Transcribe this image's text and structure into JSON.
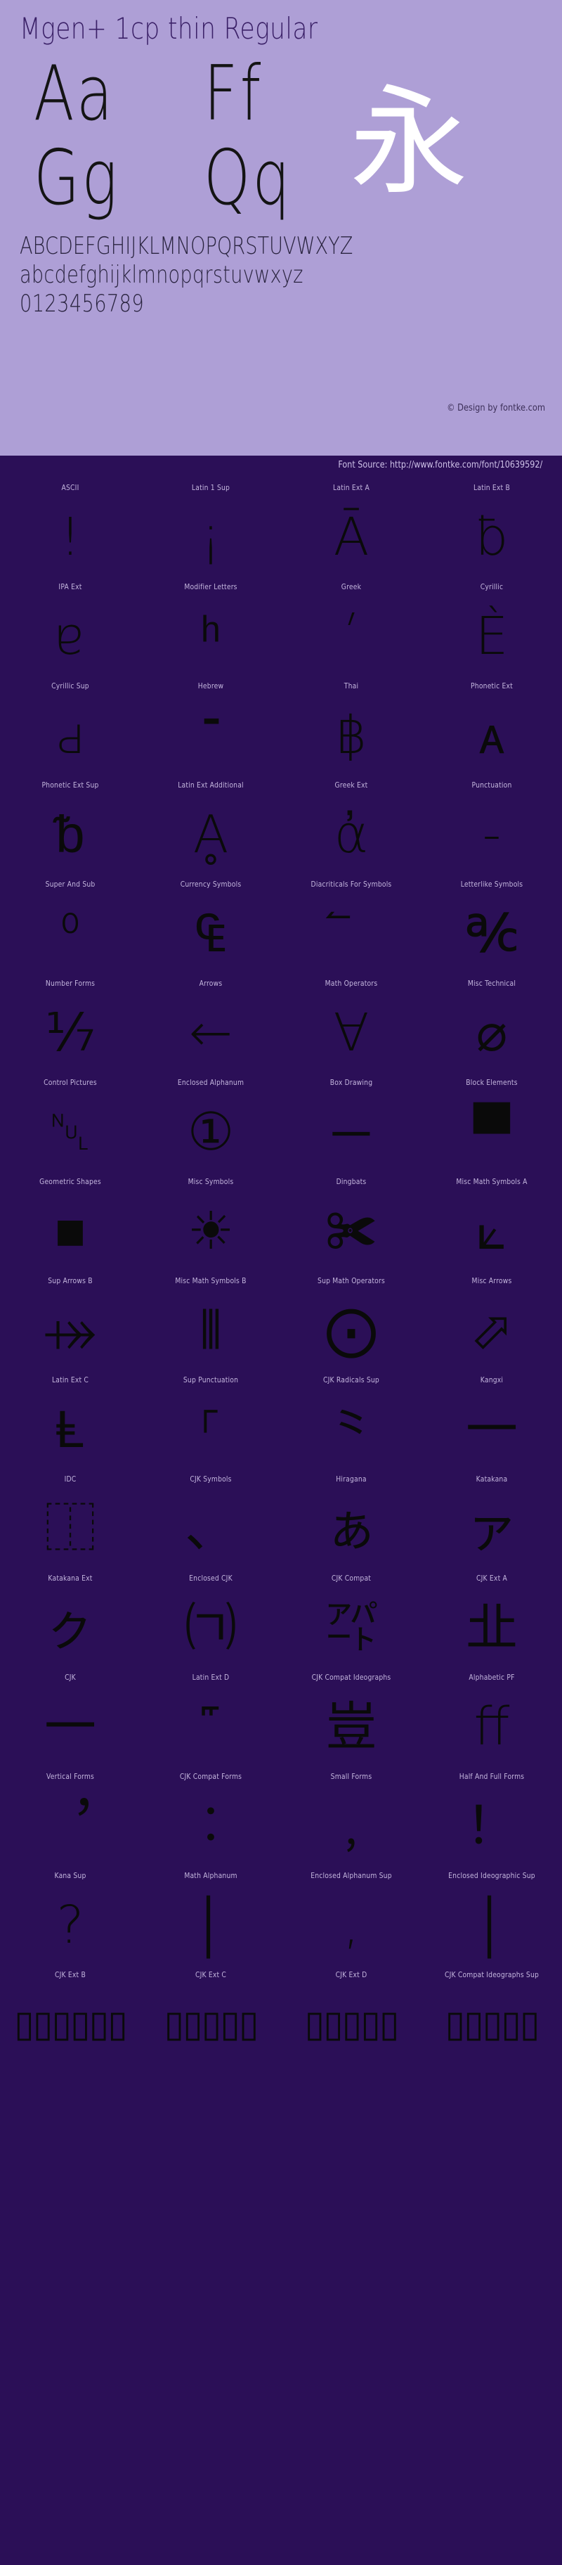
{
  "header": {
    "title": "Mgen+ 1cp thin Regular",
    "specimen_pairs": [
      "Aa",
      "Ff",
      "Gg",
      "Qq"
    ],
    "cjk_sample": "永",
    "uppercase": "ABCDEFGHIJKLMNOPQRSTUVWXYZ",
    "lowercase": "abcdefghijklmnopqrstuvwxyz",
    "digits": "0123456789",
    "copyright": "© Design by fontke.com",
    "bg_color": "#ae9fd6",
    "text_color": "#2a2440",
    "cjk_color": "#ffffff"
  },
  "source_bar": {
    "text": "Font Source: http://www.fontke.com/font/10639592/",
    "bg_color": "#2b0f57",
    "text_color": "#cfc2e8"
  },
  "blocks": [
    {
      "label": "ASCII",
      "glyph": "!"
    },
    {
      "label": "Latin 1 Sup",
      "glyph": "¡"
    },
    {
      "label": "Latin Ext A",
      "glyph": "Ā"
    },
    {
      "label": "Latin Ext B",
      "glyph": "ƀ"
    },
    {
      "label": "IPA Ext",
      "glyph": "ɐ"
    },
    {
      "label": "Modifier Letters",
      "glyph": "ʰ"
    },
    {
      "label": "Greek",
      "glyph": "ʹ"
    },
    {
      "label": "Cyrillic",
      "glyph": "Ѐ"
    },
    {
      "label": "Cyrillic Sup",
      "glyph": "ԁ"
    },
    {
      "label": "Hebrew",
      "glyph": "־"
    },
    {
      "label": "Thai",
      "glyph": "฿"
    },
    {
      "label": "Phonetic Ext",
      "glyph": "ᴀ"
    },
    {
      "label": "Phonetic Ext Sup",
      "glyph": "ᵬ"
    },
    {
      "label": "Latin Ext Additional",
      "glyph": "Ḁ"
    },
    {
      "label": "Greek Ext",
      "glyph": "ἀ"
    },
    {
      "label": "Punctuation",
      "glyph": "‐"
    },
    {
      "label": "Super And Sub",
      "glyph": "⁰"
    },
    {
      "label": "Currency Symbols",
      "glyph": "₠"
    },
    {
      "label": "Diacriticals For Symbols",
      "glyph": "⃐"
    },
    {
      "label": "Letterlike Symbols",
      "glyph": "℀"
    },
    {
      "label": "Number Forms",
      "glyph": "⅐"
    },
    {
      "label": "Arrows",
      "glyph": "←"
    },
    {
      "label": "Math Operators",
      "glyph": "∀"
    },
    {
      "label": "Misc Technical",
      "glyph": "⌀"
    },
    {
      "label": "Control Pictures",
      "glyph": "␀"
    },
    {
      "label": "Enclosed Alphanum",
      "glyph": "①"
    },
    {
      "label": "Box Drawing",
      "glyph": "─"
    },
    {
      "label": "Block Elements",
      "glyph": "▀"
    },
    {
      "label": "Geometric Shapes",
      "glyph": "■"
    },
    {
      "label": "Misc Symbols",
      "glyph": "☀"
    },
    {
      "label": "Dingbats",
      "glyph": "✀"
    },
    {
      "label": "Misc Math Symbols A",
      "glyph": "⟀"
    },
    {
      "label": "Sup Arrows B",
      "glyph": "⤀"
    },
    {
      "label": "Misc Math Symbols B",
      "glyph": "⦀"
    },
    {
      "label": "Sup Math Operators",
      "glyph": "⨀"
    },
    {
      "label": "Misc Arrows",
      "glyph": "⬀"
    },
    {
      "label": "Latin Ext C",
      "glyph": "Ⱡ"
    },
    {
      "label": "Sup Punctuation",
      "glyph": "⸀"
    },
    {
      "label": "CJK Radicals Sup",
      "glyph": "⺀"
    },
    {
      "label": "Kangxi",
      "glyph": "⼀"
    },
    {
      "label": "IDC",
      "glyph": "⿰"
    },
    {
      "label": "CJK Symbols",
      "glyph": "、"
    },
    {
      "label": "Hiragana",
      "glyph": "ぁ"
    },
    {
      "label": "Katakana",
      "glyph": "ァ"
    },
    {
      "label": "Katakana Ext",
      "glyph": "ㇰ"
    },
    {
      "label": "Enclosed CJK",
      "glyph": "㈀"
    },
    {
      "label": "CJK Compat",
      "glyph": "㌀"
    },
    {
      "label": "CJK Ext A",
      "glyph": "㐀"
    },
    {
      "label": "CJK",
      "glyph": "一"
    },
    {
      "label": "Latin Ext D",
      "glyph": "꜠"
    },
    {
      "label": "CJK Compat Ideographs",
      "glyph": "豈"
    },
    {
      "label": "Alphabetic PF",
      "glyph": "ﬀ"
    },
    {
      "label": "Vertical Forms",
      "glyph": "︐"
    },
    {
      "label": "CJK Compat Forms",
      "glyph": "︰"
    },
    {
      "label": "Small Forms",
      "glyph": "﹐"
    },
    {
      "label": "Half And Full Forms",
      "glyph": "！"
    },
    {
      "label": "Kana Sup",
      "glyph": "?"
    },
    {
      "label": "Math Alphanum",
      "glyph": "│"
    },
    {
      "label": "Enclosed Alphanum Sup",
      "glyph": ","
    },
    {
      "label": "Enclosed Ideographic Sup",
      "glyph": "│"
    },
    {
      "label": "CJK Ext B",
      "glyph": "▯▯▯▯▯▯"
    },
    {
      "label": "CJK Ext C",
      "glyph": "▯▯▯▯▯"
    },
    {
      "label": "CJK Ext D",
      "glyph": "▯▯▯▯▯"
    },
    {
      "label": "CJK Compat Ideographs Sup",
      "glyph": "▯▯▯▯▯"
    }
  ]
}
